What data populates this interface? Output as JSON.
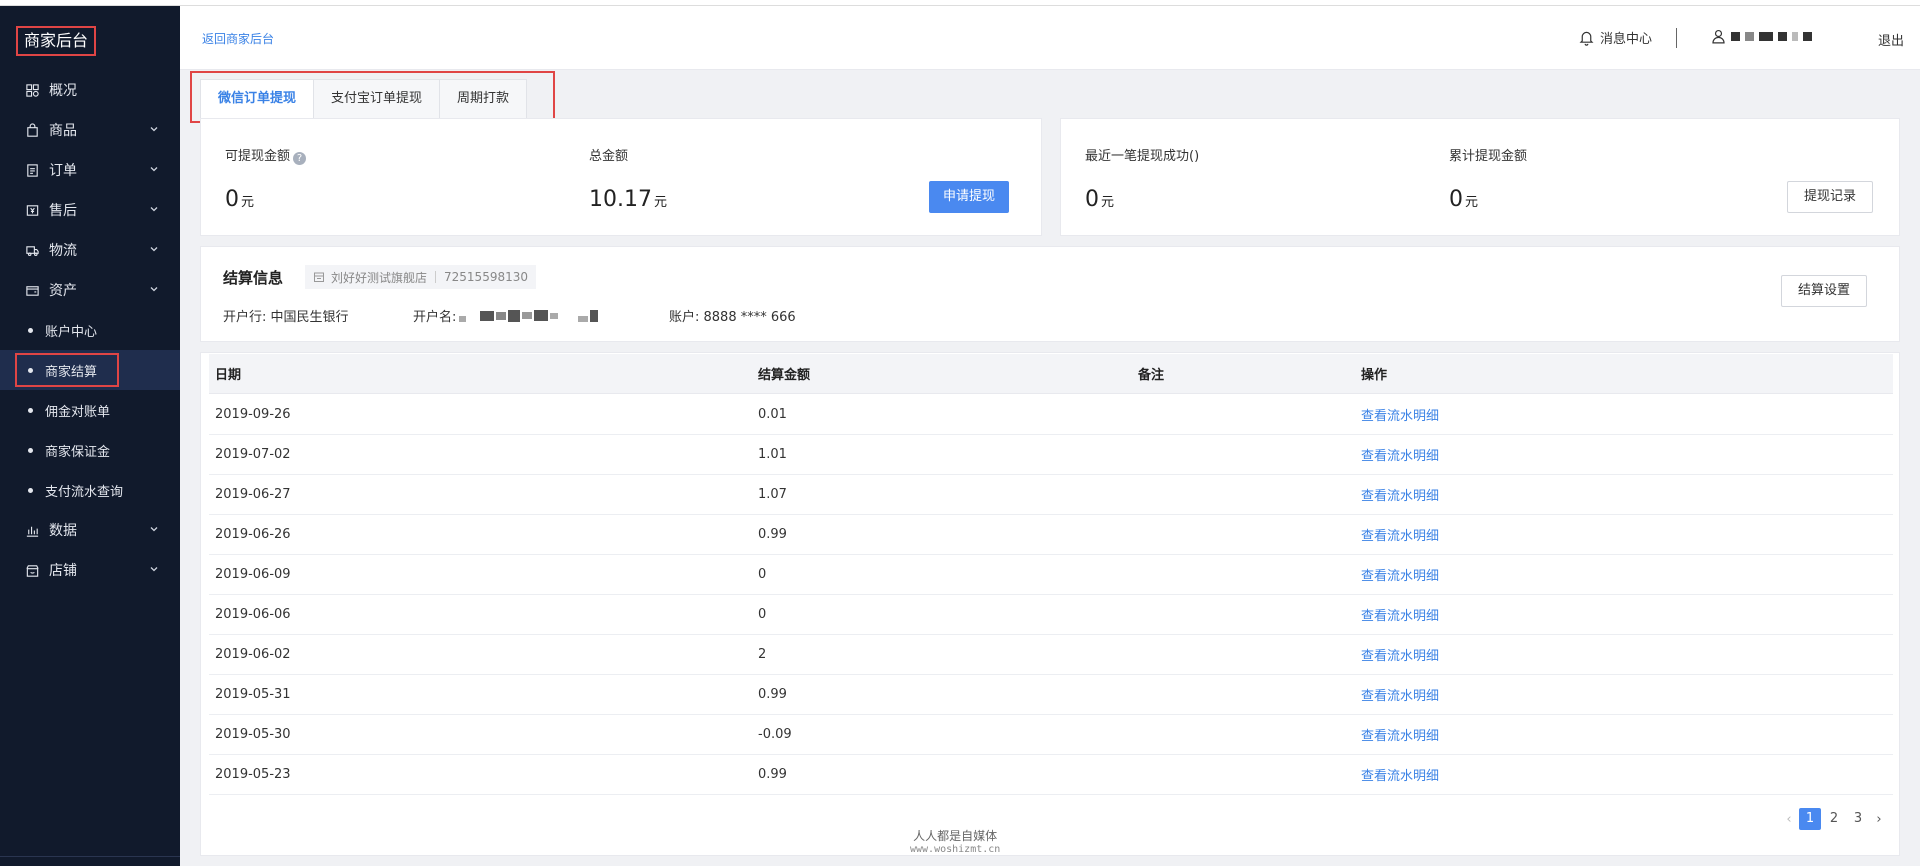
{
  "sidebar": {
    "brand": "商家后台",
    "items": [
      {
        "label": "概况",
        "icon": "dashboard-icon",
        "expandable": false
      },
      {
        "label": "商品",
        "icon": "bag-icon",
        "expandable": true
      },
      {
        "label": "订单",
        "icon": "list-icon",
        "expandable": true
      },
      {
        "label": "售后",
        "icon": "aftersale-icon",
        "expandable": true
      },
      {
        "label": "物流",
        "icon": "truck-icon",
        "expandable": true
      },
      {
        "label": "资产",
        "icon": "wallet-icon",
        "expandable": true
      }
    ],
    "asset_sub": [
      "账户中心",
      "商家结算",
      "佣金对账单",
      "商家保证金",
      "支付流水查询"
    ],
    "active_sub": "商家结算",
    "items_after": [
      {
        "label": "数据",
        "icon": "chart-icon",
        "expandable": true
      },
      {
        "label": "店铺",
        "icon": "store-icon",
        "expandable": true
      }
    ]
  },
  "header": {
    "back_link": "返回商家后台",
    "message_center": "消息中心",
    "logout": "退出"
  },
  "tabs": [
    "微信订单提现",
    "支付宝订单提现",
    "周期打款"
  ],
  "active_tab": "微信订单提现",
  "balance": {
    "withdrawable_label": "可提现金额",
    "withdrawable_value": "0",
    "total_label": "总金额",
    "total_value": "10.17",
    "unit": "元",
    "apply_button": "申请提现"
  },
  "recent": {
    "last_success_label": "最近一笔提现成功()",
    "last_success_value": "0",
    "cumulative_label": "累计提现金额",
    "cumulative_value": "0",
    "unit": "元",
    "record_button": "提现记录"
  },
  "settlement": {
    "title": "结算信息",
    "shop_name": "刘好好测试旗舰店",
    "shop_id": "72515598130",
    "bank_label": "开户行: 中国民生银行",
    "account_name_label": "开户名:",
    "account_label": "账户: 8888 **** 666",
    "settings_button": "结算设置"
  },
  "table": {
    "columns": [
      "日期",
      "结算金额",
      "备注",
      "操作"
    ],
    "action_label": "查看流水明细",
    "rows": [
      {
        "date": "2019-09-26",
        "amount": "0.01",
        "note": ""
      },
      {
        "date": "2019-07-02",
        "amount": "1.01",
        "note": ""
      },
      {
        "date": "2019-06-27",
        "amount": "1.07",
        "note": ""
      },
      {
        "date": "2019-06-26",
        "amount": "0.99",
        "note": ""
      },
      {
        "date": "2019-06-09",
        "amount": "0",
        "note": ""
      },
      {
        "date": "2019-06-06",
        "amount": "0",
        "note": ""
      },
      {
        "date": "2019-06-02",
        "amount": "2",
        "note": ""
      },
      {
        "date": "2019-05-31",
        "amount": "0.99",
        "note": ""
      },
      {
        "date": "2019-05-30",
        "amount": "-0.09",
        "note": ""
      },
      {
        "date": "2019-05-23",
        "amount": "0.99",
        "note": ""
      }
    ]
  },
  "pagination": {
    "pages": [
      "1",
      "2",
      "3"
    ],
    "current": "1",
    "prev": "‹",
    "next": "›"
  },
  "watermark": {
    "line1": "人人都是自媒体",
    "line2": "www.woshizmt.cn"
  },
  "colors": {
    "sidebar_bg": "#111a2c",
    "accent": "#4a89f0",
    "highlight_frame": "#e04545"
  }
}
